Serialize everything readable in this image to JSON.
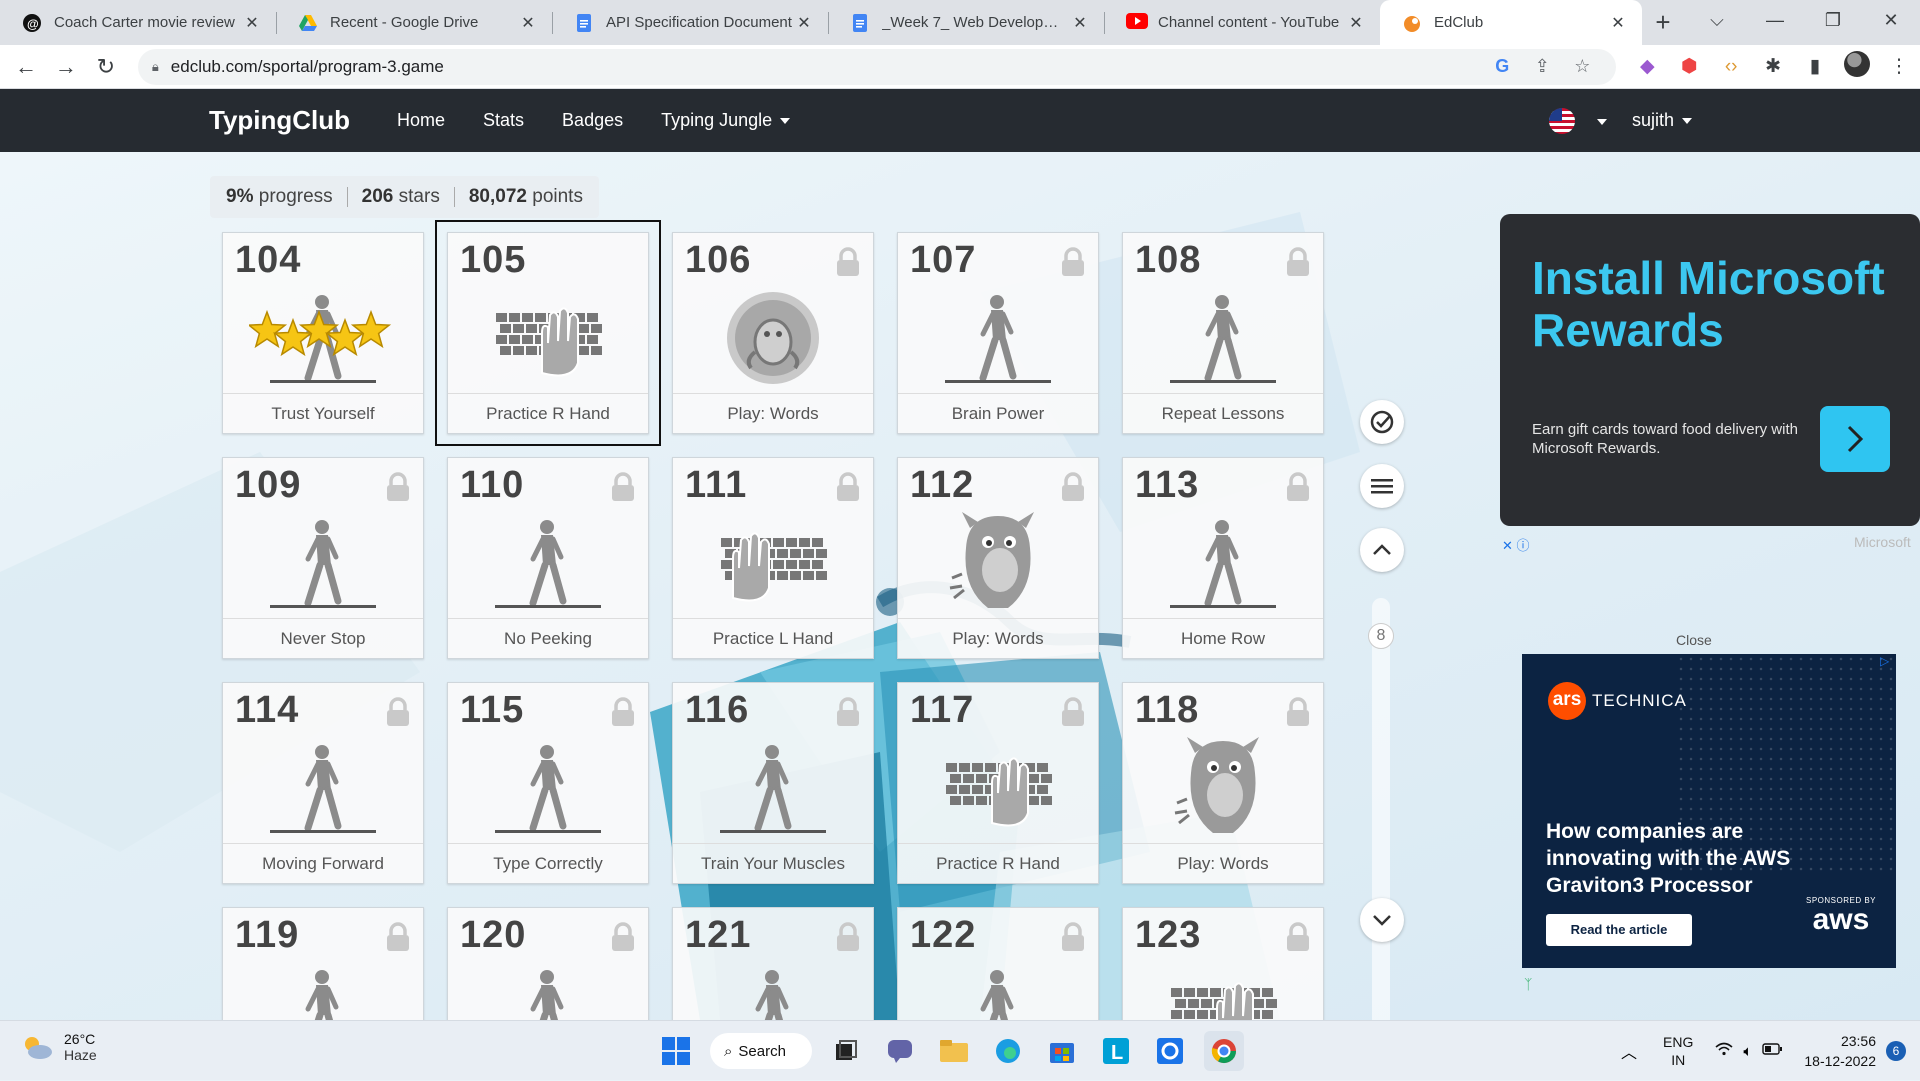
{
  "browser": {
    "tabs": [
      {
        "title": "Coach Carter movie review",
        "icon": "threads-icon",
        "color": "#111111"
      },
      {
        "title": "Recent - Google Drive",
        "icon": "google-drive-icon",
        "color": "#1fa463"
      },
      {
        "title": "API Specification Document",
        "icon": "google-docs-icon",
        "color": "#4285f4"
      },
      {
        "title": "_Week 7_ Web Development",
        "icon": "google-docs-icon",
        "color": "#4285f4"
      },
      {
        "title": "Channel content - YouTube",
        "icon": "youtube-icon",
        "color": "#ff0000"
      },
      {
        "title": "EdClub",
        "icon": "edclub-icon",
        "color": "#f28c28"
      }
    ],
    "url": "edclub.com/sportal/program-3.game"
  },
  "site": {
    "logo": "TypingClub",
    "nav": [
      "Home",
      "Stats",
      "Badges",
      "Typing Jungle"
    ],
    "user": "sujith"
  },
  "stats": {
    "progress_value": "9%",
    "progress_label": "progress",
    "stars_value": "206",
    "stars_label": "stars",
    "points_value": "80,072",
    "points_label": "points"
  },
  "lessons": [
    {
      "num": "104",
      "label": "Trust Yourself",
      "type": "walker",
      "locked": false,
      "stars": 5
    },
    {
      "num": "105",
      "label": "Practice R Hand",
      "type": "keyboard-right",
      "locked": false,
      "selected": true
    },
    {
      "num": "106",
      "label": "Play: Words",
      "type": "game-badge",
      "locked": true
    },
    {
      "num": "107",
      "label": "Brain Power",
      "type": "walker",
      "locked": true
    },
    {
      "num": "108",
      "label": "Repeat Lessons",
      "type": "walker",
      "locked": true
    },
    {
      "num": "109",
      "label": "Never Stop",
      "type": "walker",
      "locked": true
    },
    {
      "num": "110",
      "label": "No Peeking",
      "type": "walker",
      "locked": true
    },
    {
      "num": "111",
      "label": "Practice L Hand",
      "type": "keyboard-left",
      "locked": true
    },
    {
      "num": "112",
      "label": "Play: Words",
      "type": "game-creature",
      "locked": true
    },
    {
      "num": "113",
      "label": "Home Row",
      "type": "walker",
      "locked": true
    },
    {
      "num": "114",
      "label": "Moving Forward",
      "type": "walker",
      "locked": true
    },
    {
      "num": "115",
      "label": "Type Correctly",
      "type": "walker",
      "locked": true
    },
    {
      "num": "116",
      "label": "Train Your Muscles",
      "type": "walker",
      "locked": true
    },
    {
      "num": "117",
      "label": "Practice R Hand",
      "type": "keyboard-right",
      "locked": true
    },
    {
      "num": "118",
      "label": "Play: Words",
      "type": "game-creature",
      "locked": true
    },
    {
      "num": "119",
      "label": "",
      "type": "walker",
      "locked": true
    },
    {
      "num": "120",
      "label": "",
      "type": "walker",
      "locked": true
    },
    {
      "num": "121",
      "label": "",
      "type": "walker",
      "locked": true
    },
    {
      "num": "122",
      "label": "",
      "type": "walker",
      "locked": true
    },
    {
      "num": "123",
      "label": "",
      "type": "keyboard-right",
      "locked": true
    }
  ],
  "page_indicator": "8",
  "ad_rewards": {
    "headline": "Install Microsoft Rewards",
    "body": "Earn gift cards toward food delivery with Microsoft Rewards.",
    "brand": "Microsoft"
  },
  "ad_ars": {
    "close": "Close",
    "logo_short": "ars",
    "logo_text": "TECHNICA",
    "headline": "How companies are innovating with the AWS Graviton3 Processor",
    "cta": "Read the article",
    "sponsored": "SPONSORED BY",
    "sponsor": "aws"
  },
  "taskbar": {
    "temp": "26°C",
    "weather": "Haze",
    "search": "Search",
    "lang1": "ENG",
    "lang2": "IN",
    "time": "23:56",
    "date": "18-12-2022",
    "notifications": "6"
  }
}
